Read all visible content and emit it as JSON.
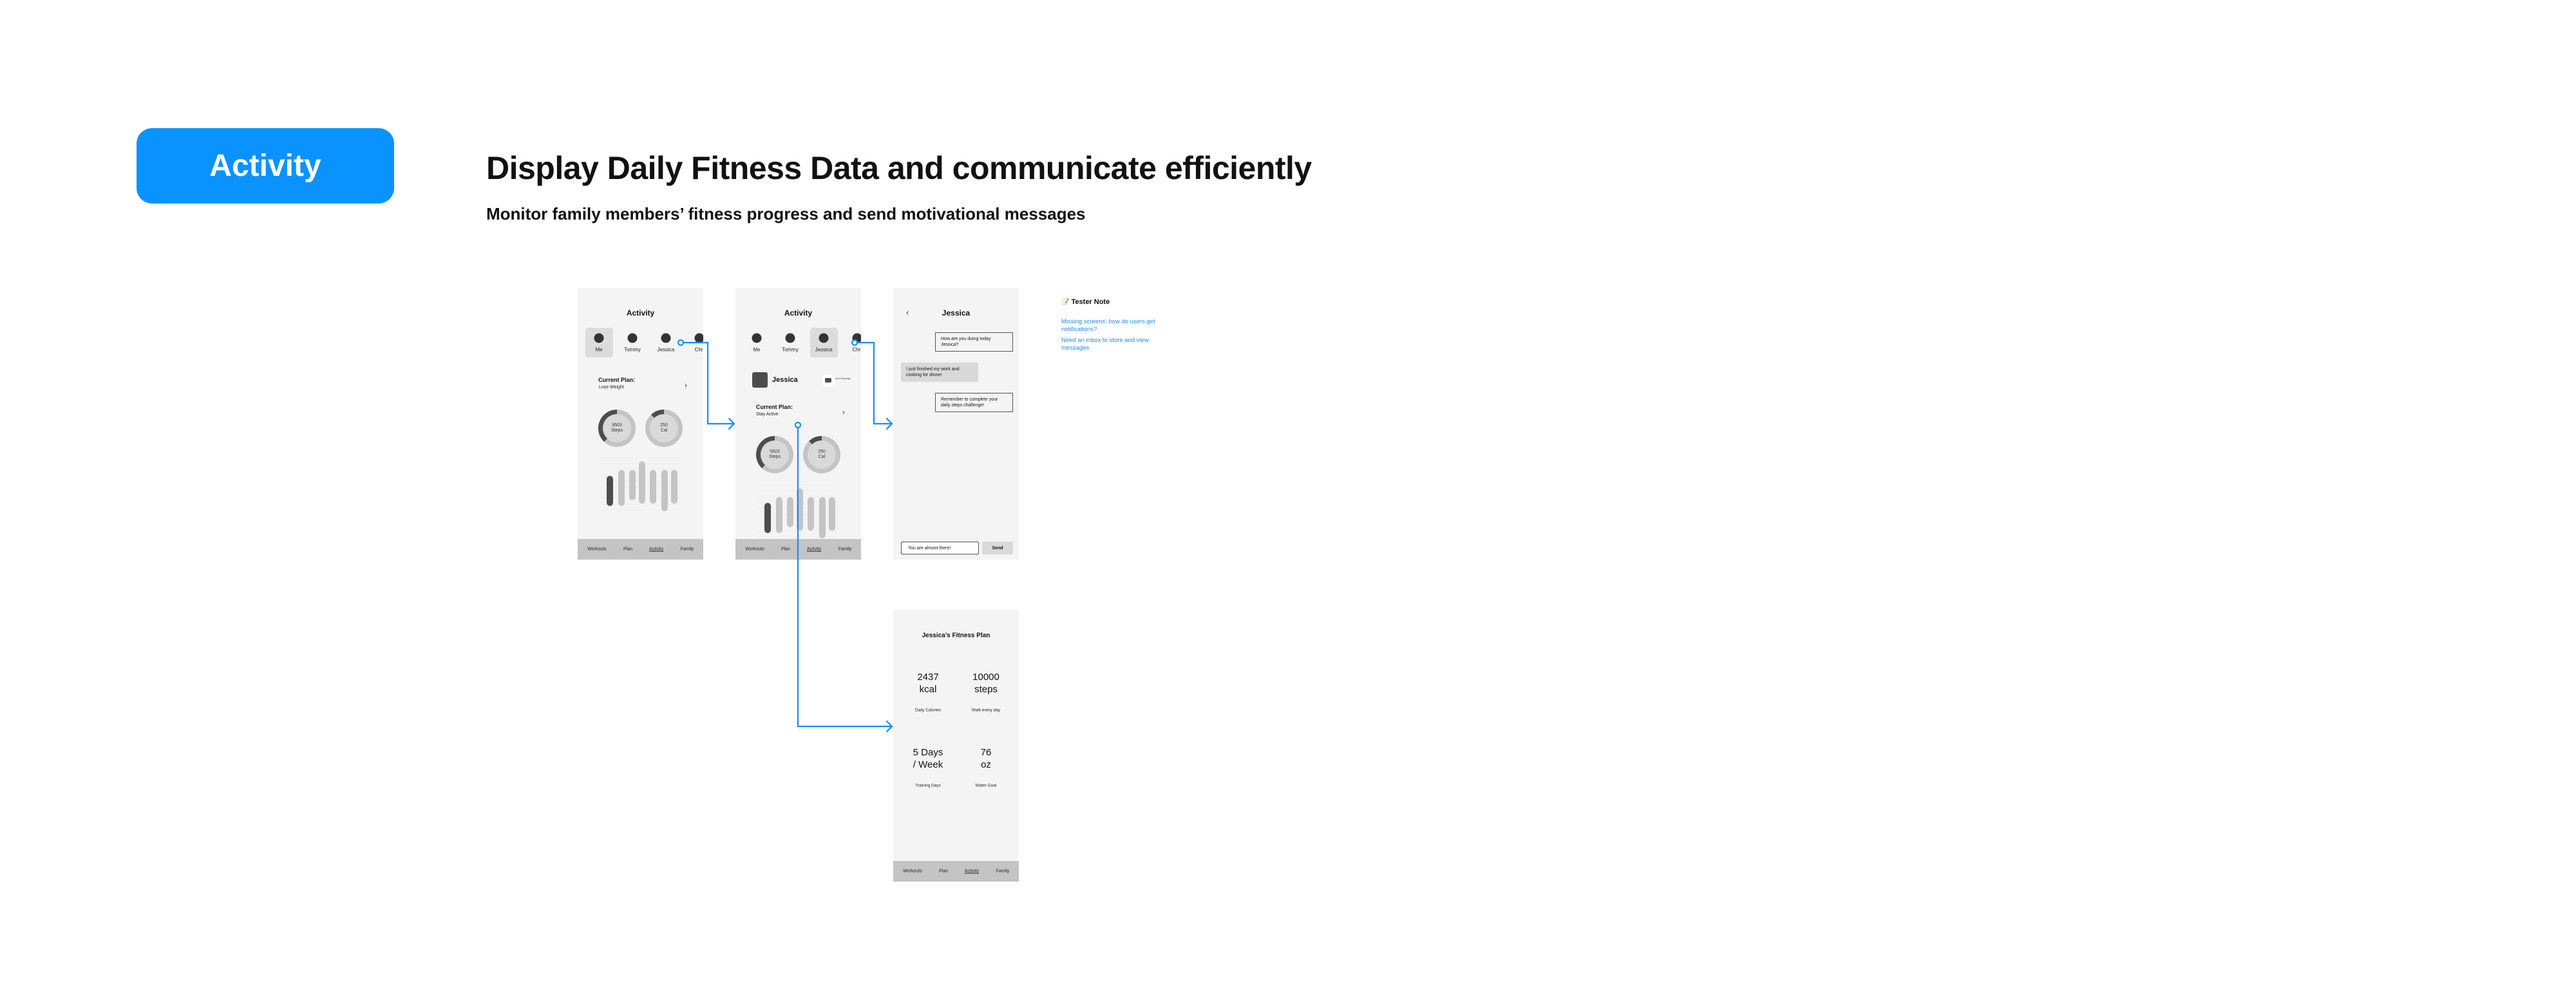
{
  "section_badge": "Activity",
  "headline": "Display Daily Fitness Data and communicate efficiently",
  "subheadline": "Monitor family members’ fitness progress and send motivational messages",
  "colors": {
    "accent": "#0a93ff",
    "connector": "#1a8cff",
    "dark": "#4d4d4d",
    "light": "#c4c4c4",
    "screen_bg": "#f4f4f4"
  },
  "members": [
    "Me",
    "Tommy",
    "Jessica",
    "Chri"
  ],
  "nav": [
    "Workouts",
    "Plan",
    "Activity",
    "Family"
  ],
  "activity_bars": [
    {
      "low": 0.7,
      "high": 5.9,
      "highlight": true
    },
    {
      "low": 0.7,
      "high": 6.9
    },
    {
      "low": 1.7,
      "high": 6.9
    },
    {
      "low": 1.1,
      "high": 8.4
    },
    {
      "low": 1.1,
      "high": 6.9
    },
    {
      "low": -0.2,
      "high": 6.9
    },
    {
      "low": 1.1,
      "high": 6.9
    }
  ],
  "screen_me": {
    "title": "Activity",
    "selected_member": "Me",
    "plan_label": "Current Plan:",
    "plan_name": "Lose Weight",
    "steps": {
      "value": "9503",
      "unit": "Steps",
      "progress": 0.38
    },
    "calories": {
      "value": "250",
      "unit": "Cal",
      "progress": 0.12
    }
  },
  "screen_jessica": {
    "title": "Activity",
    "selected_member": "Jessica",
    "profile_name": "Jessica",
    "send_message": "Send Message",
    "plan_label": "Current Plan:",
    "plan_name": "Stay Active",
    "steps": {
      "value": "5923",
      "unit": "Steps",
      "progress": 0.38
    },
    "calories": {
      "value": "250",
      "unit": "Cal",
      "progress": 0.12
    }
  },
  "screen_chat": {
    "title": "Jessica",
    "messages": [
      {
        "from": "me",
        "text": "How are you doing today Jessica?"
      },
      {
        "from": "them",
        "text": "I just finished my work and cooking for dinner"
      },
      {
        "from": "me",
        "text": "Remember to complete your daily steps challenge!"
      }
    ],
    "input_value": "You are almost there!",
    "send_label": "Send"
  },
  "screen_plan": {
    "title": "Jessica’s Fitness Plan",
    "stats": [
      {
        "value": "2437",
        "unit": "kcal",
        "label": "Daily Calories"
      },
      {
        "value": "10000",
        "unit": "steps",
        "label": "Walk every day"
      },
      {
        "value": "5 Days",
        "unit": "/ Week",
        "label": "Training Days"
      },
      {
        "value": "76",
        "unit": "oz",
        "label": "Water Goal"
      }
    ]
  },
  "tester_note": {
    "icon": "memo-icon",
    "title": "Tester Note",
    "items": [
      "Missing screens: how do users get notifications?",
      "Need an inbox to store and view messages"
    ]
  }
}
